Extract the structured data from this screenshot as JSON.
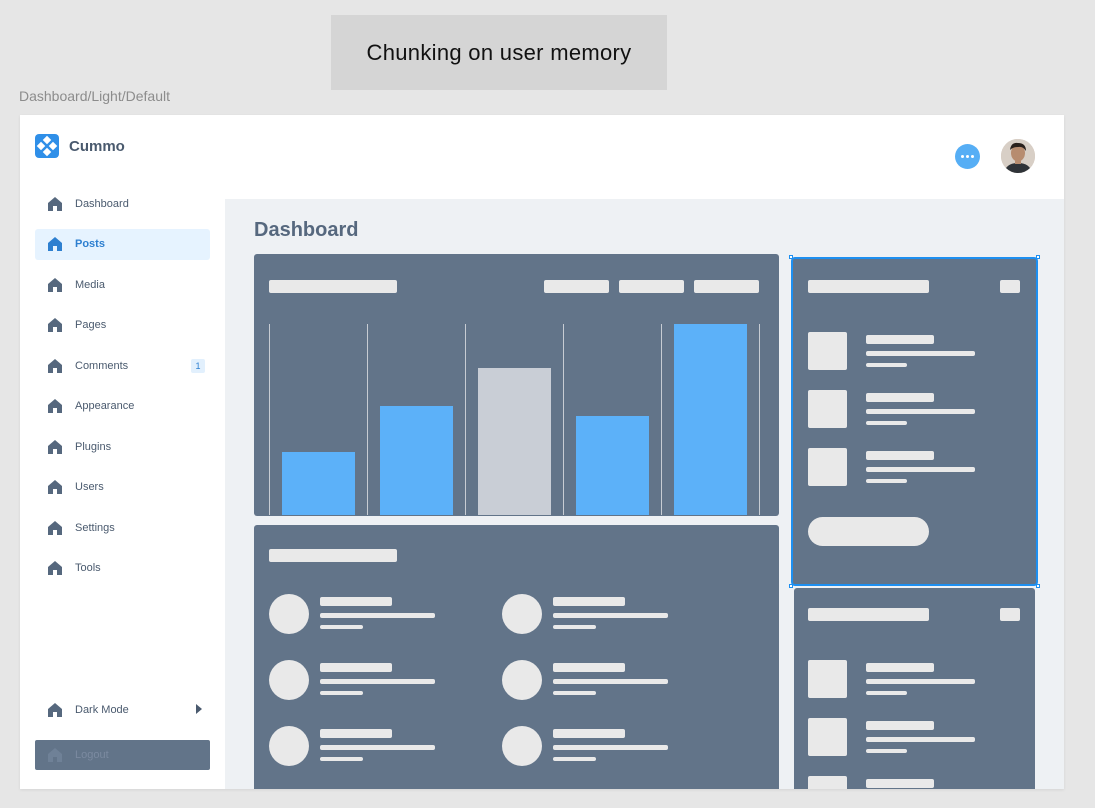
{
  "banner": {
    "text": "Chunking on user memory"
  },
  "frame_label": "Dashboard/Light/Default",
  "brand": {
    "name": "Cummo",
    "logo_icon": "logo-icon",
    "color": "#2f8fe8"
  },
  "sidebar": {
    "items": [
      {
        "label": "Dashboard",
        "icon": "home-icon",
        "active": false
      },
      {
        "label": "Posts",
        "icon": "home-icon",
        "active": true
      },
      {
        "label": "Media",
        "icon": "home-icon",
        "active": false
      },
      {
        "label": "Pages",
        "icon": "home-icon",
        "active": false
      },
      {
        "label": "Comments",
        "icon": "home-icon",
        "active": false,
        "badge": "1"
      },
      {
        "label": "Appearance",
        "icon": "home-icon",
        "active": false
      },
      {
        "label": "Plugins",
        "icon": "home-icon",
        "active": false
      },
      {
        "label": "Users",
        "icon": "home-icon",
        "active": false
      },
      {
        "label": "Settings",
        "icon": "home-icon",
        "active": false
      },
      {
        "label": "Tools",
        "icon": "home-icon",
        "active": false
      }
    ],
    "dark_mode": {
      "label": "Dark Mode",
      "icon": "home-icon"
    },
    "logout": {
      "label": "Logout",
      "icon": "home-icon"
    }
  },
  "header": {
    "chat_icon": "chat-bubble-icon",
    "avatar_icon": "user-avatar"
  },
  "main": {
    "title": "Dashboard"
  },
  "colors": {
    "accent": "#2f8fe8",
    "card": "#627489",
    "bar_highlight": "#5cb1f9",
    "bar_muted": "#c9ced6",
    "placeholder": "#e9e9e9",
    "active_nav_bg": "#e6f3ff"
  },
  "chart_data": {
    "type": "bar",
    "categories": [
      "",
      "",
      "",
      "",
      ""
    ],
    "values": [
      33,
      57,
      77,
      52,
      100
    ],
    "highlight": [
      true,
      true,
      false,
      true,
      true
    ],
    "ylim": [
      0,
      100
    ],
    "title": "",
    "xlabel": "",
    "ylabel": "",
    "grid": true
  }
}
